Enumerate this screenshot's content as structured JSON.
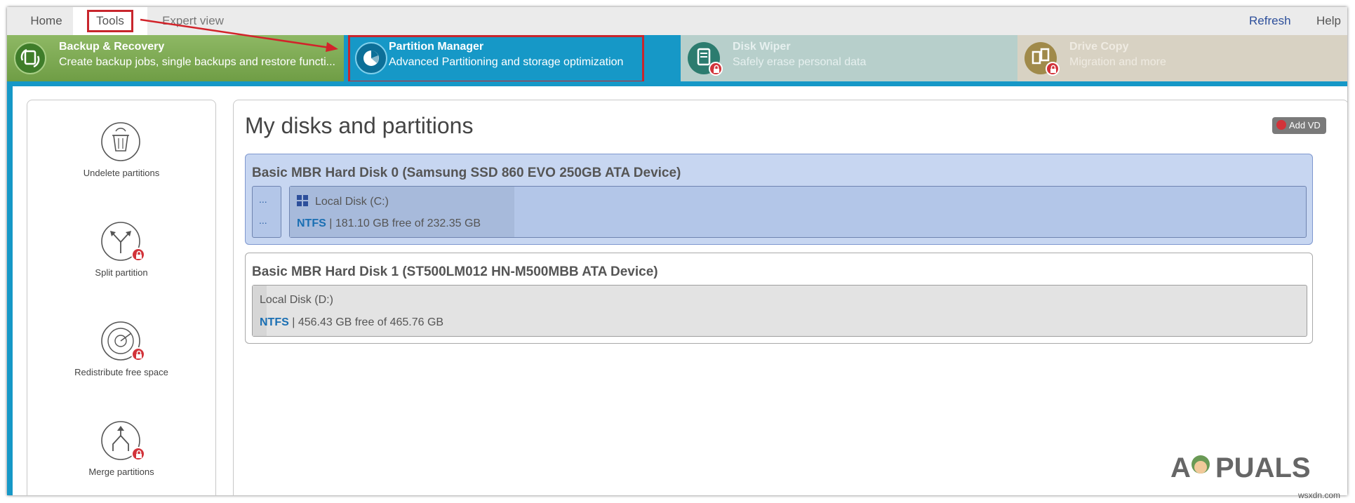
{
  "nav": {
    "home": "Home",
    "tools": "Tools",
    "expert": "Expert view",
    "refresh": "Refresh",
    "help": "Help"
  },
  "tiles": [
    {
      "title": "Backup & Recovery",
      "subtitle": "Create backup jobs, single backups and restore functi...",
      "locked": false
    },
    {
      "title": "Partition Manager",
      "subtitle": "Advanced Partitioning and storage optimization",
      "locked": false
    },
    {
      "title": "Disk Wiper",
      "subtitle": "Safely erase personal data",
      "locked": true
    },
    {
      "title": "Drive Copy",
      "subtitle": "Migration and more",
      "locked": true
    }
  ],
  "actions": [
    {
      "label": "Undelete partitions",
      "icon": "undelete-icon",
      "locked": false
    },
    {
      "label": "Split partition",
      "icon": "split-icon",
      "locked": true
    },
    {
      "label": "Redistribute free space",
      "icon": "redistribute-icon",
      "locked": true
    },
    {
      "label": "Merge partitions",
      "icon": "merge-icon",
      "locked": true
    }
  ],
  "main": {
    "title": "My disks and partitions",
    "add_vd": "Add VD",
    "disks": [
      {
        "title": "Basic MBR Hard Disk 0 (Samsung SSD 860 EVO 250GB ATA Device)",
        "small_partition": [
          "...",
          "..."
        ],
        "partition": {
          "name": "Local Disk (C:)",
          "fs": "NTFS",
          "info": "| 181.10 GB free of 232.35 GB"
        }
      },
      {
        "title": "Basic MBR Hard Disk 1 (ST500LM012 HN-M500MBB ATA Device)",
        "partition": {
          "name": "Local Disk (D:)",
          "fs": "NTFS",
          "info": "| 456.43 GB free of 465.76 GB"
        }
      }
    ]
  },
  "watermark": "A PUALS",
  "site": "wsxdn.com",
  "colors": {
    "accent": "#1698c7",
    "highlight": "#c8262d",
    "backup_tile": "#7aa650",
    "lock": "#d2333a",
    "disk_selected": "#c7d6f1",
    "fs_text": "#1a6fb3"
  }
}
